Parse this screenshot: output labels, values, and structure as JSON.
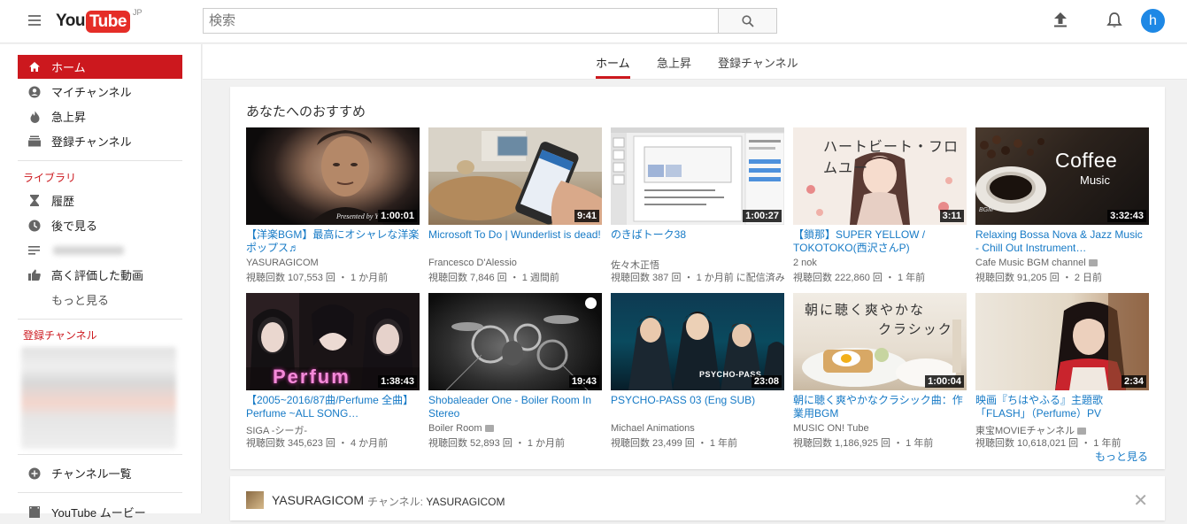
{
  "header": {
    "logo_you": "You",
    "logo_tube": "Tube",
    "logo_region": "JP",
    "search_placeholder": "検索",
    "avatar_letter": "h"
  },
  "sidebar": {
    "items": [
      {
        "label": "ホーム",
        "icon": "home-icon"
      },
      {
        "label": "マイチャンネル",
        "icon": "account-icon"
      },
      {
        "label": "急上昇",
        "icon": "flame-icon"
      },
      {
        "label": "登録チャンネル",
        "icon": "subscriptions-icon"
      }
    ],
    "library_title": "ライブラリ",
    "library": [
      {
        "label": "履歴",
        "icon": "hourglass-icon"
      },
      {
        "label": "後で見る",
        "icon": "clock-icon"
      },
      {
        "label": "",
        "icon": "playlist-icon"
      },
      {
        "label": "高く評価した動画",
        "icon": "thumbs-up-icon"
      }
    ],
    "more": "もっと見る",
    "subs_title": "登録チャンネル",
    "channel_list": "チャンネル一覧",
    "movies": "YouTube ムービー"
  },
  "tabs": [
    {
      "label": "ホーム"
    },
    {
      "label": "急上昇"
    },
    {
      "label": "登録チャンネル"
    }
  ],
  "section": {
    "title": "あなたへのおすすめ",
    "more": "もっと見る",
    "videos": [
      {
        "title": "【洋楽BGM】最高にオシャレな洋楽ポップス♬",
        "channel": "YASURAGICOM",
        "meta": "視聴回数 107,553 回 ・ 1 か月前",
        "duration": "1:00:01",
        "thumb_text": "Presented by Y"
      },
      {
        "title": "Microsoft To Do | Wunderlist is dead!",
        "channel": "Francesco D'Alessio",
        "meta": "視聴回数 7,846 回 ・ 1 週間前",
        "duration": "9:41"
      },
      {
        "title": "のきばトーク38",
        "channel": "佐々木正悟",
        "meta": "視聴回数 387 回 ・ 1 か月前 に配信済み",
        "duration": "1:00:27"
      },
      {
        "title": "【鎖那】SUPER YELLOW / TOKOTOKO(西沢さんP)",
        "channel": "2 nok",
        "meta": "視聴回数 222,860 回 ・ 1 年前",
        "duration": "3:11",
        "thumb_text": "ハートビート・フロムユー"
      },
      {
        "title": "Relaxing Bossa Nova & Jazz Music - Chill Out Instrument…",
        "channel": "Cafe Music BGM channel",
        "meta": "視聴回数 91,205 回 ・ 2 日前",
        "duration": "3:32:43",
        "thumb_text": "Coffee",
        "thumb_sub": "Music",
        "thumb_logo": "BGM",
        "verified": true
      },
      {
        "title": "【2005~2016/87曲/Perfume 全曲】Perfume ~ALL SONG…",
        "channel": "SIGA -シーガ-",
        "meta": "視聴回数 345,623 回 ・ 4 か月前",
        "duration": "1:38:43",
        "thumb_text": "Perfum"
      },
      {
        "title": "Shobaleader One - Boiler Room In Stereo",
        "channel": "Boiler Room",
        "meta": "視聴回数 52,893 回 ・ 1 か月前",
        "duration": "19:43",
        "verified": true
      },
      {
        "title": "PSYCHO-PASS 03 (Eng SUB)",
        "channel": "Michael Animations",
        "meta": "視聴回数 23,499 回 ・ 1 年前",
        "duration": "23:08",
        "thumb_text": "PSYCHO-PASS"
      },
      {
        "title": "朝に聴く爽やかなクラシック曲：作業用BGM",
        "channel": "MUSIC ON! Tube",
        "meta": "視聴回数 1,186,925 回 ・ 1 年前",
        "duration": "1:00:04",
        "thumb_text": "朝に聴く爽やかな",
        "thumb_sub": "クラシック"
      },
      {
        "title": "映画『ちはやふる』主題歌「FLASH」（Perfume）PV",
        "channel": "東宝MOVIEチャンネル",
        "meta": "視聴回数 10,618,021 回 ・ 1 年前",
        "duration": "2:34",
        "verified": true
      }
    ]
  },
  "channel_row": {
    "name": "YASURAGICOM",
    "label": "チャンネル:",
    "channel": "YASURAGICOM"
  }
}
